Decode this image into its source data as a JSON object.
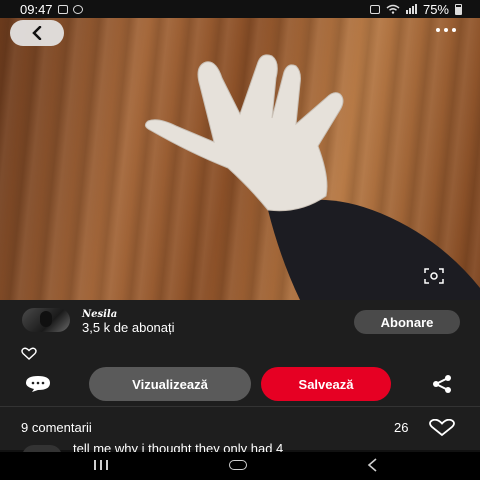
{
  "status_bar": {
    "time": "09:47",
    "battery": "75%",
    "left_icons": [
      "image-icon",
      "whatsapp-icon"
    ],
    "right_icons": [
      "camera-icon",
      "wifi-icon",
      "signal-icon",
      "battery-icon"
    ]
  },
  "pin": {
    "image_icons": [
      "back-icon",
      "more-icon",
      "visual-search-icon"
    ]
  },
  "creator": {
    "name": "Nesila",
    "followers": "3,5 k de abonați",
    "follow_label": "Abonare"
  },
  "actions": {
    "view_label": "Vizualizează",
    "save_label": "Salvează",
    "save_color": "#e60023",
    "view_color": "#5a5a5a"
  },
  "comments": {
    "count_label": "9 comentarii",
    "likes": "26",
    "first_comment": "tell me why i thought they only had 4"
  },
  "nav_bar": {
    "icons": [
      "recent-apps-icon",
      "home-icon",
      "back-nav-icon"
    ]
  }
}
